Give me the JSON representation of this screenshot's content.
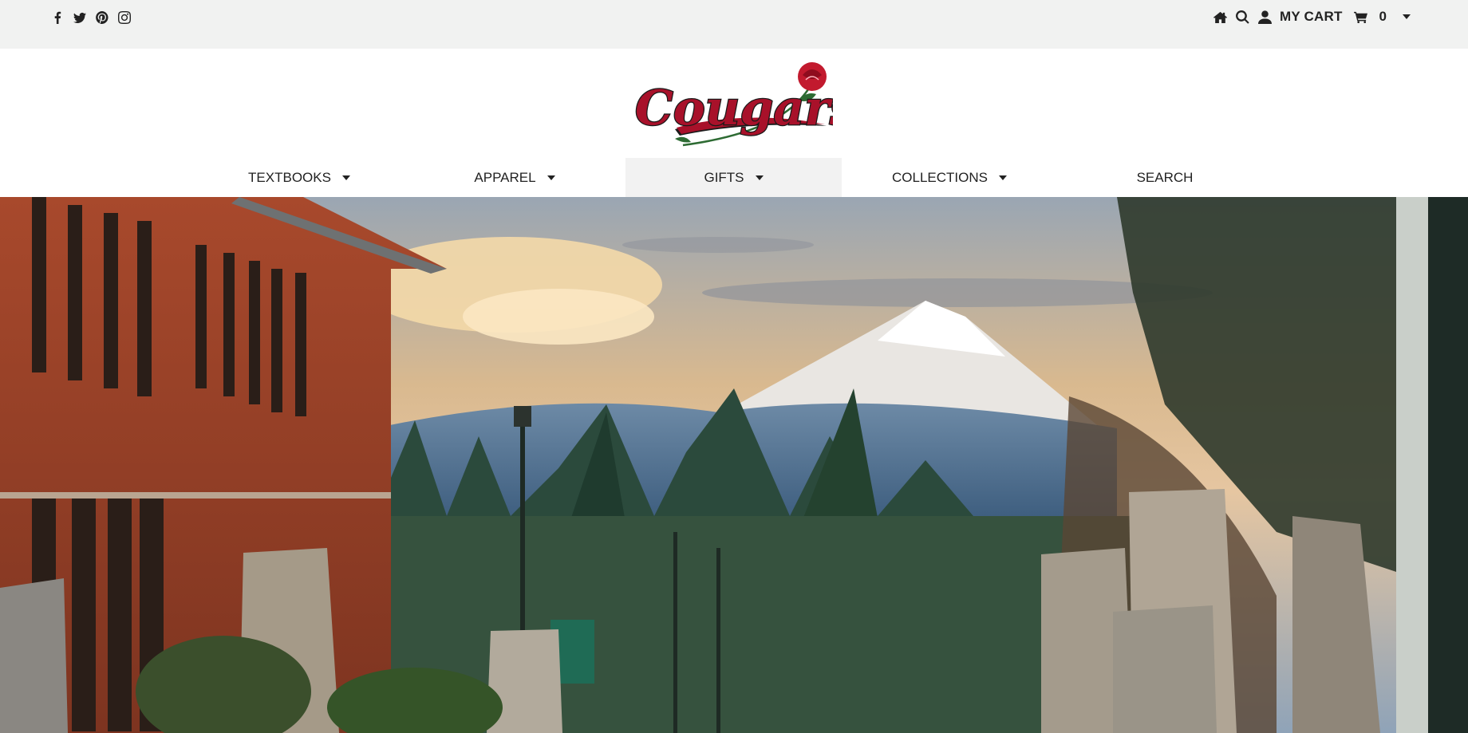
{
  "topbar": {
    "social": [
      {
        "name": "facebook-icon"
      },
      {
        "name": "twitter-icon"
      },
      {
        "name": "pinterest-icon"
      },
      {
        "name": "instagram-icon"
      }
    ],
    "cart_label": "MY CART",
    "cart_count": "0"
  },
  "logo": {
    "text": "Cougars",
    "accent_color": "#a8112a"
  },
  "nav": {
    "items": [
      {
        "label": "TEXTBOOKS",
        "has_dropdown": true
      },
      {
        "label": "APPAREL",
        "has_dropdown": true
      },
      {
        "label": "GIFTS",
        "has_dropdown": true,
        "active": true
      },
      {
        "label": "COLLECTIONS",
        "has_dropdown": true
      },
      {
        "label": "SEARCH",
        "has_dropdown": false
      }
    ]
  },
  "hero": {
    "description_icon": "campus-mountain-photo"
  },
  "colors": {
    "topbar_bg": "#f1f2f1",
    "brand_red": "#a8112a",
    "text": "#222222"
  }
}
